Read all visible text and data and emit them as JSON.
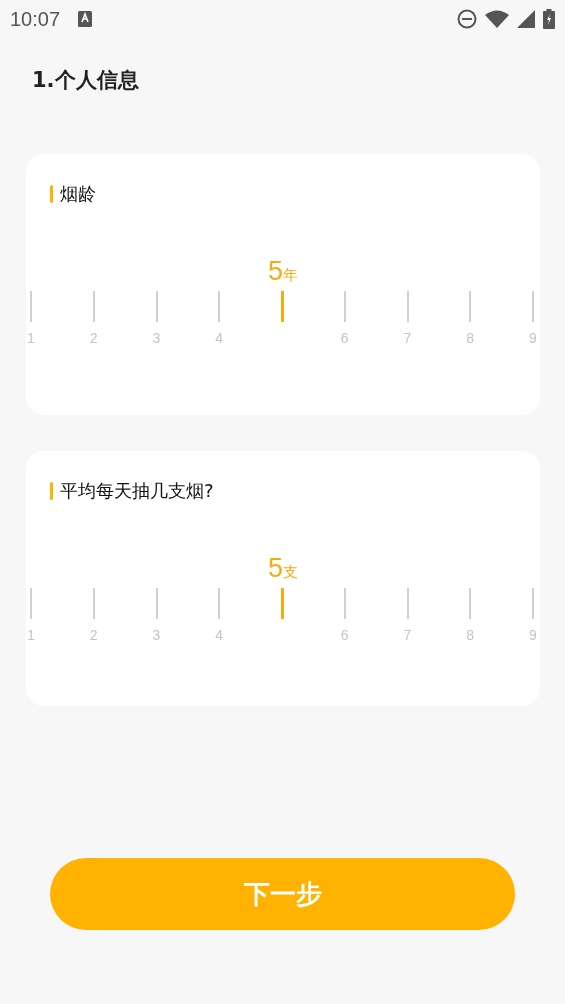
{
  "status_bar": {
    "time": "10:07"
  },
  "title": "1.个人信息",
  "questions": [
    {
      "label": "烟龄",
      "value": "5",
      "unit": "年",
      "ticks": [
        {
          "label": "1",
          "selected": false
        },
        {
          "label": "2",
          "selected": false
        },
        {
          "label": "3",
          "selected": false
        },
        {
          "label": "4",
          "selected": false
        },
        {
          "selected": true
        },
        {
          "label": "6",
          "selected": false
        },
        {
          "label": "7",
          "selected": false
        },
        {
          "label": "8",
          "selected": false
        },
        {
          "label": "9",
          "selected": false
        }
      ]
    },
    {
      "label": "平均每天抽几支烟?",
      "value": "5",
      "unit": "支",
      "ticks": [
        {
          "label": "1",
          "selected": false
        },
        {
          "label": "2",
          "selected": false
        },
        {
          "label": "3",
          "selected": false
        },
        {
          "label": "4",
          "selected": false
        },
        {
          "selected": true
        },
        {
          "label": "6",
          "selected": false
        },
        {
          "label": "7",
          "selected": false
        },
        {
          "label": "8",
          "selected": false
        },
        {
          "label": "9",
          "selected": false
        }
      ]
    }
  ],
  "next_button": "下一步"
}
